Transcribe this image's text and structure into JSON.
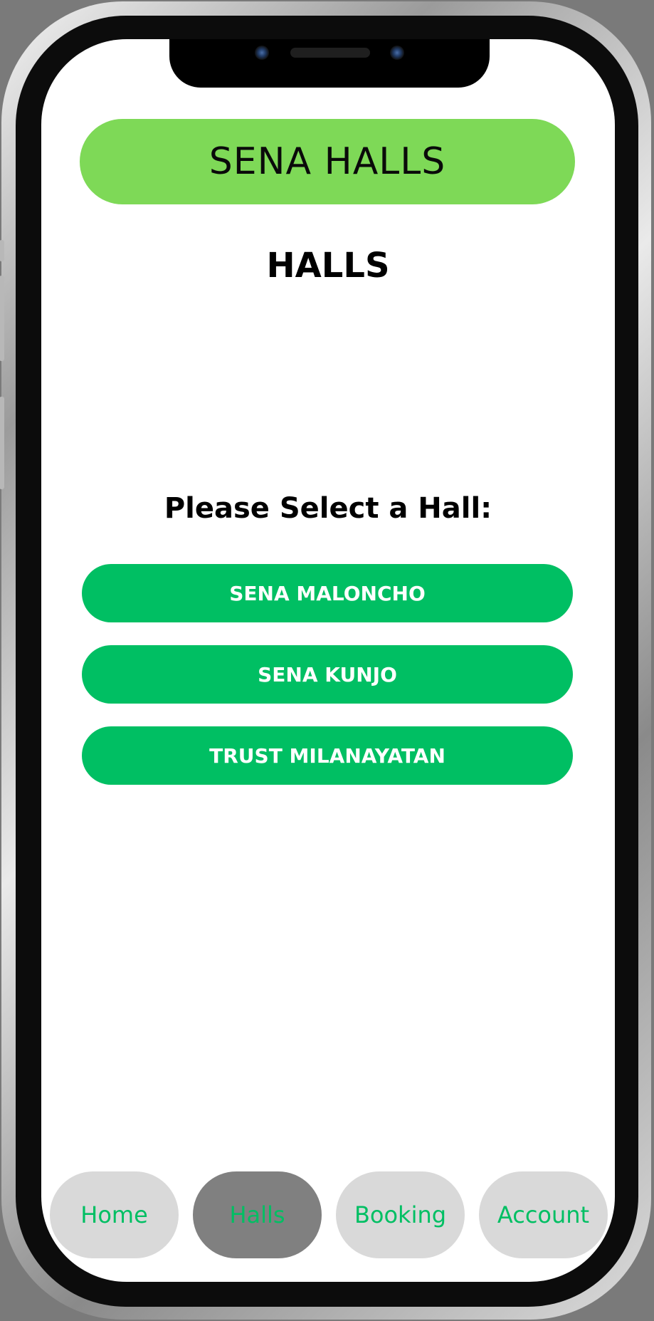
{
  "header": {
    "brand": "SENA HALLS"
  },
  "page": {
    "title": "HALLS",
    "prompt": "Please Select a Hall:"
  },
  "halls": [
    {
      "label": "SENA MALONCHO"
    },
    {
      "label": "SENA KUNJO"
    },
    {
      "label": "TRUST MILANAYATAN"
    }
  ],
  "nav": {
    "items": [
      {
        "label": "Home",
        "active": false
      },
      {
        "label": "Halls",
        "active": true
      },
      {
        "label": "Booking",
        "active": false
      },
      {
        "label": "Account",
        "active": false
      }
    ]
  },
  "colors": {
    "brand_green": "#7ed957",
    "button_green": "#00bf63",
    "nav_inactive": "#d9d9d9",
    "nav_active": "#808080"
  }
}
